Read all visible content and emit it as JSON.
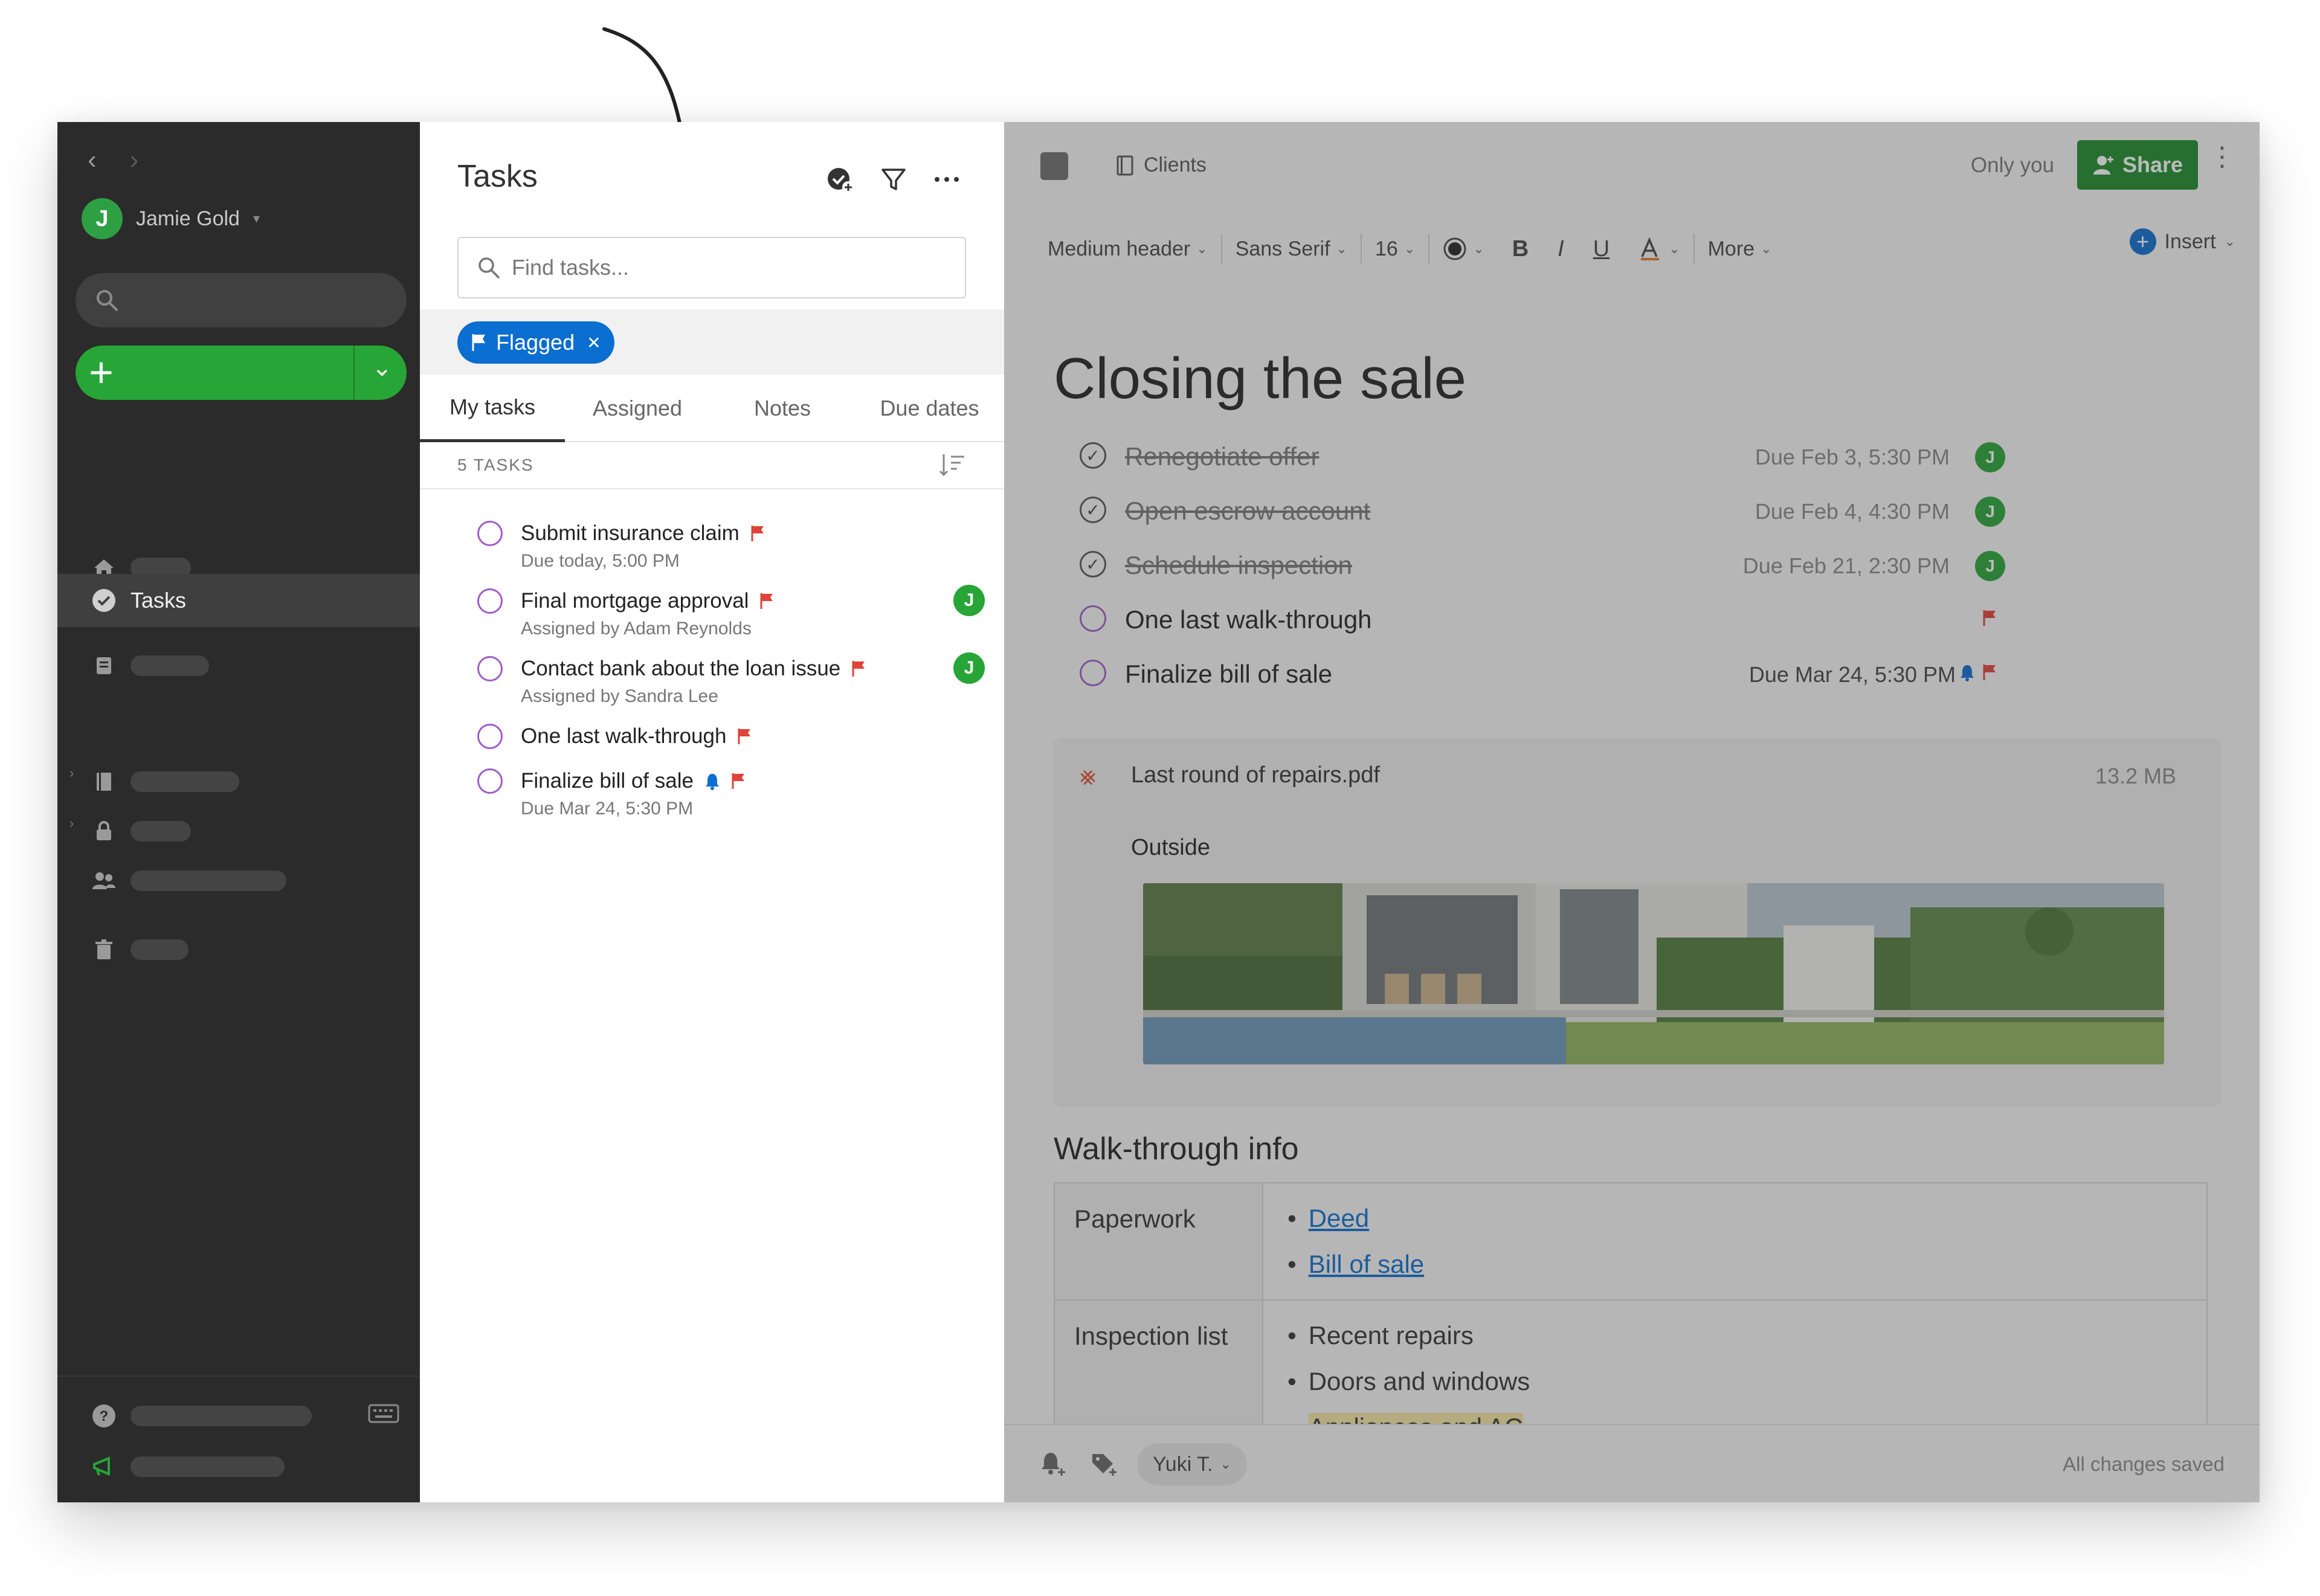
{
  "sidebar": {
    "account_initial": "J",
    "account_name": "Jamie Gold",
    "tasks_label": "Tasks",
    "icons": [
      "home-icon",
      "star-icon",
      "note-icon",
      "notebook-icon",
      "lock-icon",
      "people-icon",
      "trash-icon",
      "help-icon",
      "keyboard-icon"
    ]
  },
  "tasks_panel": {
    "title": "Tasks",
    "search_placeholder": "Find tasks...",
    "filter_chip": "Flagged",
    "tabs": [
      "My tasks",
      "Assigned",
      "Notes",
      "Due dates"
    ],
    "active_tab": "My tasks",
    "count_label": "5 TASKS",
    "items": [
      {
        "title": "Submit insurance claim",
        "sub": "Due today, 5:00 PM",
        "flag": true,
        "reminder": false,
        "avatar": ""
      },
      {
        "title": "Final mortgage approval",
        "sub": "Assigned by Adam Reynolds",
        "flag": true,
        "reminder": false,
        "avatar": "J"
      },
      {
        "title": "Contact bank about the loan issue",
        "sub": "Assigned by Sandra Lee",
        "flag": true,
        "reminder": false,
        "avatar": "J"
      },
      {
        "title": "One last walk-through",
        "sub": "",
        "flag": true,
        "reminder": false,
        "avatar": ""
      },
      {
        "title": "Finalize bill of sale",
        "sub": "Due Mar 24, 5:30 PM",
        "flag": true,
        "reminder": true,
        "avatar": ""
      }
    ]
  },
  "editor": {
    "notebook": "Clients",
    "visibility": "Only you",
    "share_label": "Share",
    "toolbar": {
      "style": "Medium header",
      "font": "Sans Serif",
      "size": "16",
      "bold": "B",
      "italic": "I",
      "underline": "U",
      "more": "More",
      "insert": "Insert"
    },
    "title": "Closing the sale",
    "checklist": [
      {
        "text": "Renegotiate offer",
        "due": "Due Feb 3, 5:30 PM",
        "done": true,
        "avatar": "J"
      },
      {
        "text": "Open escrow account",
        "due": "Due Feb 4, 4:30 PM",
        "done": true,
        "avatar": "J"
      },
      {
        "text": "Schedule inspection",
        "due": "Due Feb 21, 2:30 PM",
        "done": true,
        "avatar": "J"
      },
      {
        "text": "One last walk-through",
        "due": "",
        "done": false,
        "avatar": ""
      },
      {
        "text": "Finalize bill of sale",
        "due": "Due Mar 24, 5:30 PM",
        "done": false,
        "avatar": ""
      }
    ],
    "attachment": {
      "filename": "Last round of repairs.pdf",
      "size": "13.2 MB",
      "caption": "Outside"
    },
    "section_heading": "Walk-through info",
    "table": [
      {
        "label": "Paperwork",
        "items": [
          "Deed",
          "Bill of sale"
        ],
        "links": true
      },
      {
        "label": "Inspection list",
        "items": [
          "Recent repairs",
          "Doors and windows",
          "Appliances and AC"
        ],
        "links": false
      }
    ],
    "footer": {
      "user": "Yuki T.",
      "status": "All changes saved"
    }
  },
  "colors": {
    "brand_green": "#27a537",
    "share_green": "#1d8a2c",
    "flag_red": "#e0433a",
    "chip_blue": "#0b6ed1",
    "task_circle": "#a15cc9",
    "sidebar_bg": "#2b2b2b"
  }
}
